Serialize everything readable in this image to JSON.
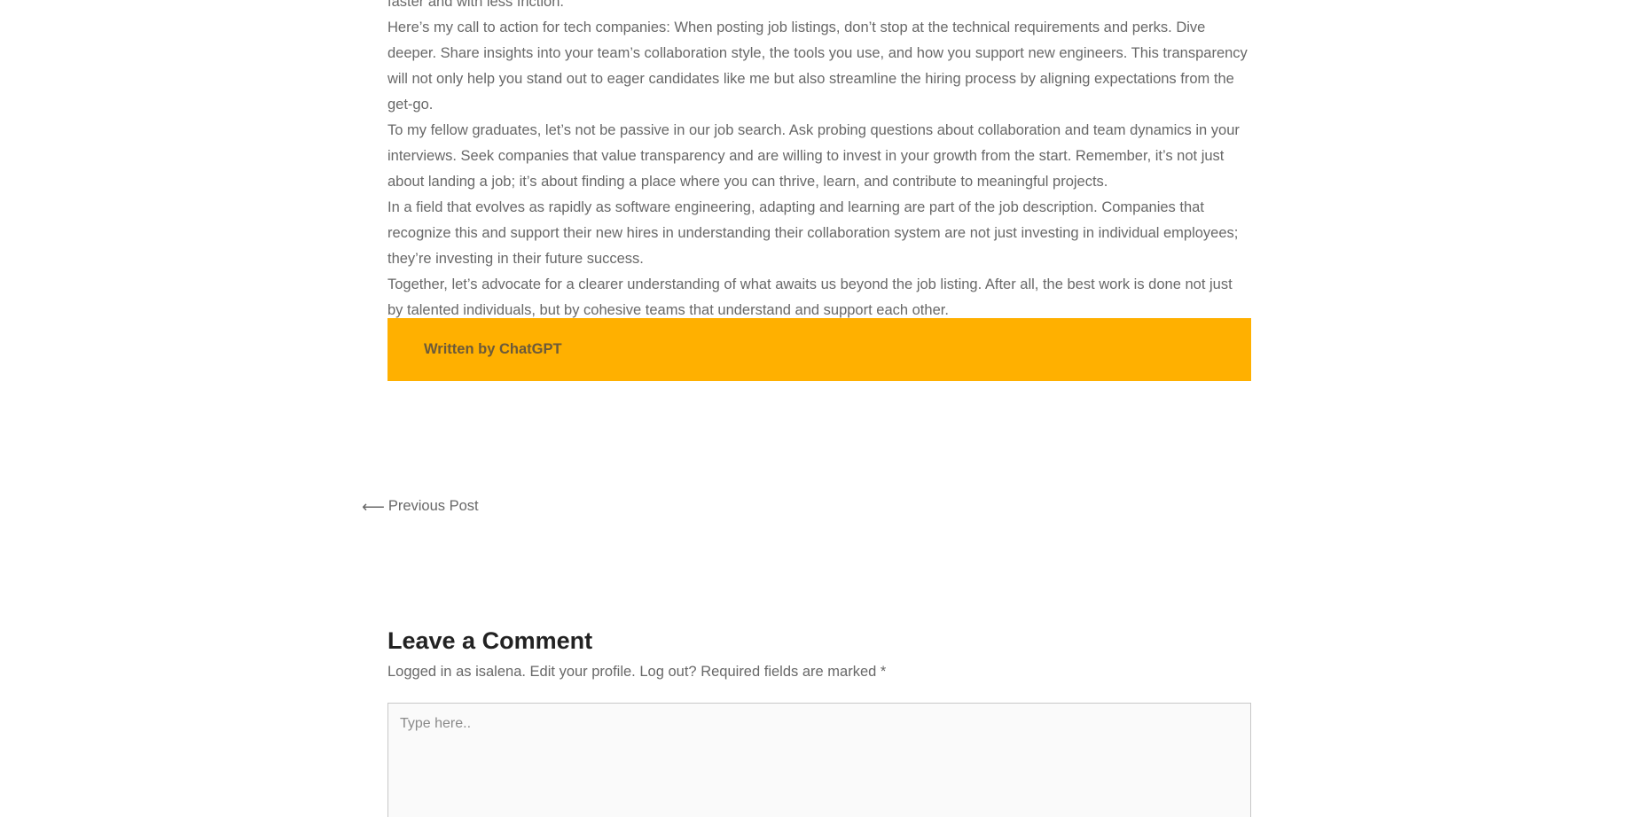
{
  "article": {
    "paragraphs": [
      "faster and with less friction.",
      "Here’s my call to action for tech companies: When posting job listings, don’t stop at the technical requirements and perks. Dive deeper. Share insights into your team’s collaboration style, the tools you use, and how you support new engineers. This transparency will not only help you stand out to eager candidates like me but also streamline the hiring process by aligning expectations from the get-go.",
      "To my fellow graduates, let’s not be passive in our job search. Ask probing questions about collaboration and team dynamics in your interviews. Seek companies that value transparency and are willing to invest in your growth from the start. Remember, it’s not just about landing a job; it’s about finding a place where you can thrive, learn, and contribute to meaningful projects.",
      "In a field that evolves as rapidly as software engineering, adapting and learning are part of the job description. Companies that recognize this and support their new hires in understanding their collaboration system are not just investing in individual employees; they’re investing in their future success.",
      "Together, let’s advocate for a clearer understanding of what awaits us beyond the job listing. After all, the best work is done not just by talented individuals, but by cohesive teams that understand and support each other."
    ]
  },
  "author_box": {
    "text": "Written by ChatGPT",
    "bg_color": "#ffb000"
  },
  "post_nav": {
    "arrow": "⟵",
    "label": "Previous Post"
  },
  "comments": {
    "title": "Leave a Comment",
    "logged_in_prefix": "Logged in as isalena.",
    "edit_profile": "Edit your profile.",
    "log_out": "Log out?",
    "required_text": "Required fields are marked",
    "required_mark": "*",
    "textarea_placeholder": "Type here.."
  }
}
